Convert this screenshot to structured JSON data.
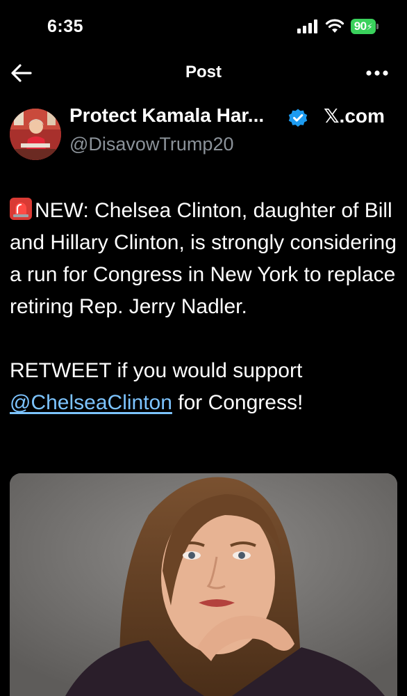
{
  "status_bar": {
    "time": "6:35",
    "battery": "90",
    "battery_color": "#3ad15c"
  },
  "nav": {
    "back_icon": "arrow-left-icon",
    "title": "Post",
    "more_icon": "more-horizontal-icon"
  },
  "post": {
    "author_name": "Protect Kamala Har...",
    "verified_color": "#1d9bf0",
    "source": "𝕏.com",
    "handle": "@DisavowTrump20",
    "line1": "NEW: Chelsea Clinton, daughter of Bill and Hillary Clinton, is strongly considering a run for Congress in New York to replace retiring Rep. Jerry Nadler.",
    "line2_before": "RETWEET if you would support ",
    "mention": "@ChelseaClinton",
    "line2_after": " for Congress!",
    "mention_color": "#7dc4ff",
    "siren_icon": "rotating-light-icon"
  }
}
